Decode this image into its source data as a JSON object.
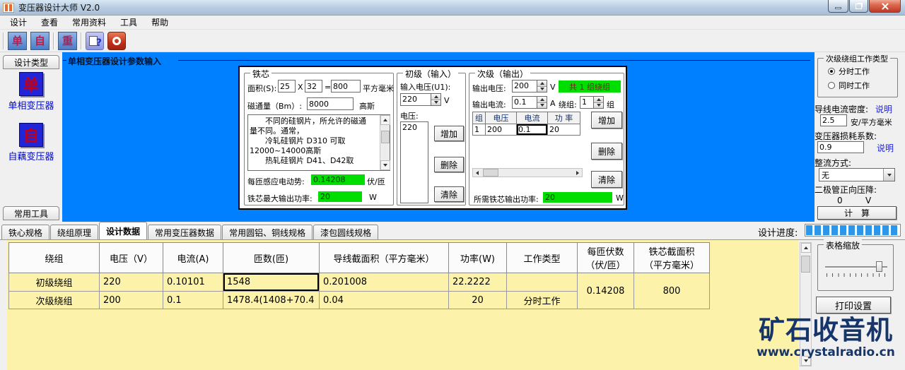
{
  "colors": {
    "workspace_blue": "#0080FF",
    "highlight_green": "#00DD00",
    "page_yellow": "#FCF2AA",
    "watermark_navy": "#16356B"
  },
  "window": {
    "title": "变压器设计大师  V2.0"
  },
  "menu": {
    "items": [
      "设计",
      "查看",
      "常用资料",
      "工具",
      "帮助"
    ]
  },
  "toolbar": {
    "buttons": [
      "单",
      "自",
      "重"
    ],
    "help_glyph": "?"
  },
  "sidebar": {
    "header": "设计类型",
    "footer": "常用工具",
    "items": [
      {
        "glyph": "单",
        "label": "单相变压器"
      },
      {
        "glyph": "自",
        "label": "自藕变压器"
      }
    ]
  },
  "workspace": {
    "title": "单相变压器设计参数输入"
  },
  "core": {
    "legend": "铁芯",
    "area_label": "面积(S):",
    "area_w": "25",
    "area_x": "X",
    "area_h": "32",
    "area_eq": "=",
    "area_total": "800",
    "area_unit": "平方毫米",
    "flux_label": "磁通量（Bm）:",
    "flux_value": "8000",
    "flux_unit": "高斯",
    "info_text": "　　不同的硅钢片，所允许的磁通\n量不同。通常，\n　　冷轧硅钢片 D310 可取\n12000~14000高斯\n　　热轧硅钢片 D41、D42取",
    "emf_label": "每匝感应电动势:",
    "emf_value": "0.14208",
    "emf_unit": "伏/匝",
    "maxp_label": "铁芯最大输出功率:",
    "maxp_value": "20",
    "maxp_unit": "W"
  },
  "primary": {
    "legend": "初级（输入）",
    "uv_label": "输入电压(U1):",
    "uv_value": "220",
    "uv_unit": "V",
    "list_label": "电压:",
    "list_items": [
      "220"
    ],
    "add": "增加",
    "del": "删除",
    "clear": "清除"
  },
  "secondary": {
    "legend": "次级（输出）",
    "ov_label": "输出电压:",
    "ov_value": "200",
    "ov_unit": "V",
    "badge": "共 1 组绕组",
    "oc_label": "输出电流:",
    "oc_value": "0.1",
    "oc_unit": "A",
    "wind_label": "绕组:",
    "wind_value": "1",
    "wind_unit": "组",
    "grid_headers": [
      "组",
      "电压",
      "电流",
      "功 率"
    ],
    "grid_row": [
      "1",
      "200",
      "0.1",
      "20"
    ],
    "add": "增加",
    "del": "删除",
    "clear": "清除",
    "req_label": "所需铁芯输出功率:",
    "req_value": "20",
    "req_unit": "W"
  },
  "right_panel": {
    "worktype_legend": "次级绕组工作类型",
    "worktype_options": [
      "分时工作",
      "同时工作"
    ],
    "density_label": "导线电流密度:",
    "density_help": "说明",
    "density_value": "2.5",
    "density_unit": "安/平方毫米",
    "loss_label": "变压器损耗系数:",
    "loss_value": "0.9",
    "loss_help": "说明",
    "rectifier_label": "整流方式:",
    "rectifier_value": "无",
    "diode_label": "二极管正向压降:",
    "diode_value": "0",
    "diode_unit": "V",
    "calc_button": "计　算"
  },
  "tabs": {
    "items": [
      "铁心规格",
      "绕组原理",
      "设计数据",
      "常用变压器数据",
      "常用圆铝、铜线规格",
      "漆包圆线规格"
    ],
    "progress_label": "设计进度:"
  },
  "results": {
    "headers": [
      "绕组",
      "电压（V）",
      "电流(A)",
      "匝数(匝)",
      "导线截面积（平方毫米）",
      "功率(W)",
      "工作类型",
      "每匝伏数\n（伏/匝）",
      "铁芯截面积\n（平方毫米）"
    ],
    "rows": [
      [
        "初级绕组",
        "220",
        "0.10101",
        "1548",
        "0.201008",
        "22.2222",
        ""
      ],
      [
        "次级绕组",
        "200",
        "0.1",
        "1478.4(1408+70.4",
        "0.04",
        "20",
        "分时工作"
      ]
    ],
    "merged_volts_per_turn": "0.14208",
    "merged_core_area": "800"
  },
  "table_tools": {
    "zoom_legend": "表格缩放",
    "print_button": "打印设置"
  },
  "watermark": {
    "title": "矿石收音机",
    "url": "www.crystalradio.cn"
  }
}
